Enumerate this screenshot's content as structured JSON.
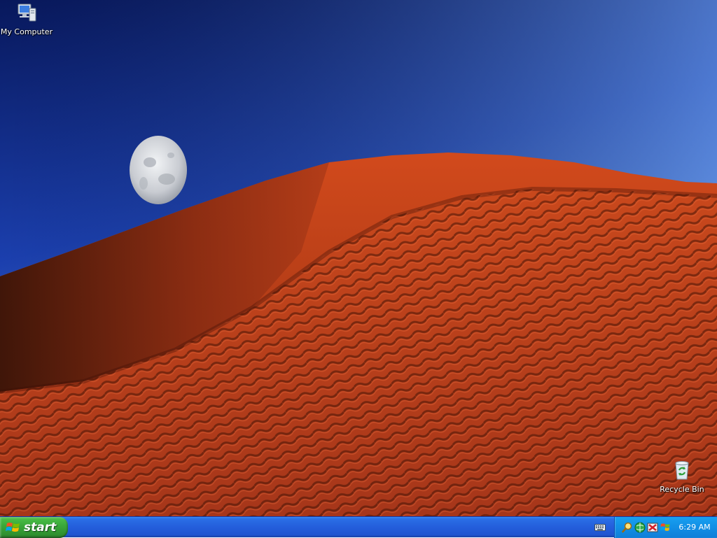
{
  "desktop": {
    "icons": [
      {
        "label": "My Computer",
        "icon": "my-computer-icon"
      },
      {
        "label": "Recycle Bin",
        "icon": "recycle-bin-icon"
      }
    ],
    "wallpaper": {
      "subject": "red sand dune with moon",
      "sky_top": "#0a1f6e",
      "sky_bottom": "#5a8fe0",
      "dune_color": "#b8411a"
    }
  },
  "taskbar": {
    "start_label": "start",
    "start_color": "#3aa83a",
    "bar_color": "#245edb",
    "tray_color": "#1290e6",
    "tray_icons": [
      "search-icon",
      "network-icon",
      "tools-icon",
      "update-icon"
    ],
    "clock": "6:29 AM"
  }
}
